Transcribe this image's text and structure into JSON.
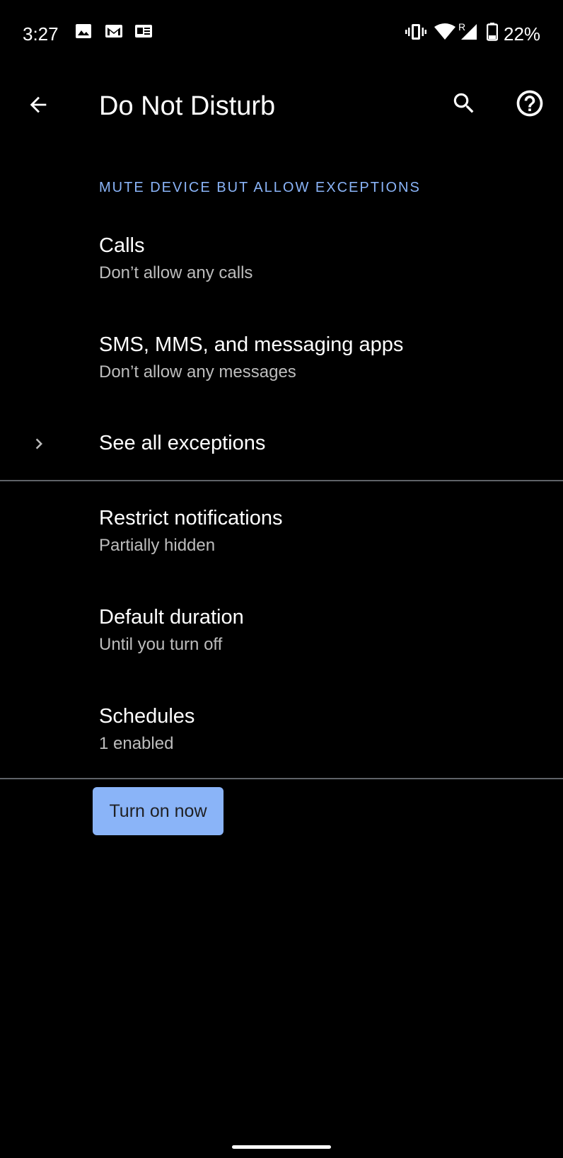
{
  "status_bar": {
    "time": "3:27",
    "battery_percent": "22%",
    "notification_icons": [
      "image-icon",
      "gmail-icon",
      "news-icon"
    ],
    "system_icons": [
      "vibrate-icon",
      "wifi-icon",
      "signal-icon",
      "battery-icon"
    ],
    "roaming_indicator": "R"
  },
  "app_bar": {
    "title": "Do Not Disturb",
    "back_icon": "arrow-back-icon",
    "search_icon": "search-icon",
    "help_icon": "help-icon"
  },
  "exceptions_section": {
    "header": "MUTE DEVICE BUT ALLOW EXCEPTIONS",
    "items": [
      {
        "title": "Calls",
        "summary": "Don’t allow any calls"
      },
      {
        "title": "SMS, MMS, and messaging apps",
        "summary": "Don’t allow any messages"
      }
    ],
    "see_all": {
      "title": "See all exceptions",
      "icon": "chevron-right-icon"
    }
  },
  "settings_section": {
    "items": [
      {
        "title": "Restrict notifications",
        "summary": "Partially hidden"
      },
      {
        "title": "Default duration",
        "summary": "Until you turn off"
      },
      {
        "title": "Schedules",
        "summary": "1 enabled"
      }
    ]
  },
  "action_button": {
    "label": "Turn on now"
  },
  "colors": {
    "background": "#000000",
    "accent": "#8ab4f8",
    "primary_text": "#ffffff",
    "secondary_text": "#bdbdbd",
    "divider": "#5f6368",
    "button_text": "#202124"
  }
}
